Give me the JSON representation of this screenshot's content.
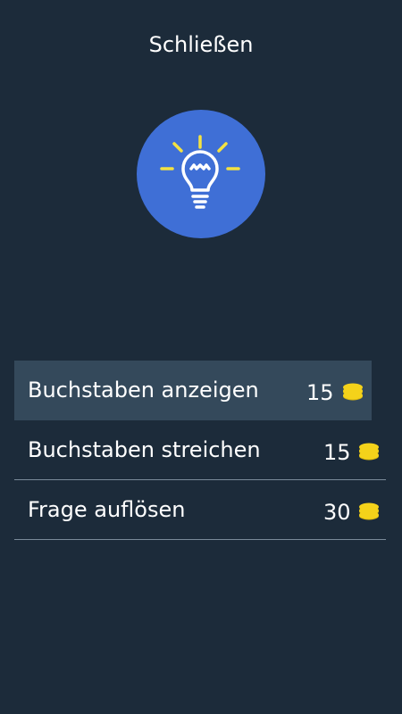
{
  "header": {
    "close_label": "Schließen"
  },
  "hint_icon": {
    "name": "lightbulb-icon",
    "circle_color": "#3f6fd6",
    "ray_color": "#f4e241"
  },
  "menu": {
    "items": [
      {
        "label": "Buchstaben anzeigen",
        "cost": "15",
        "highlighted": true
      },
      {
        "label": "Buchstaben streichen",
        "cost": "15",
        "highlighted": false
      },
      {
        "label": "Frage auflösen",
        "cost": "30",
        "highlighted": false
      }
    ],
    "coin_icon": "coin-stack-icon",
    "coin_color": "#f4d21a"
  }
}
